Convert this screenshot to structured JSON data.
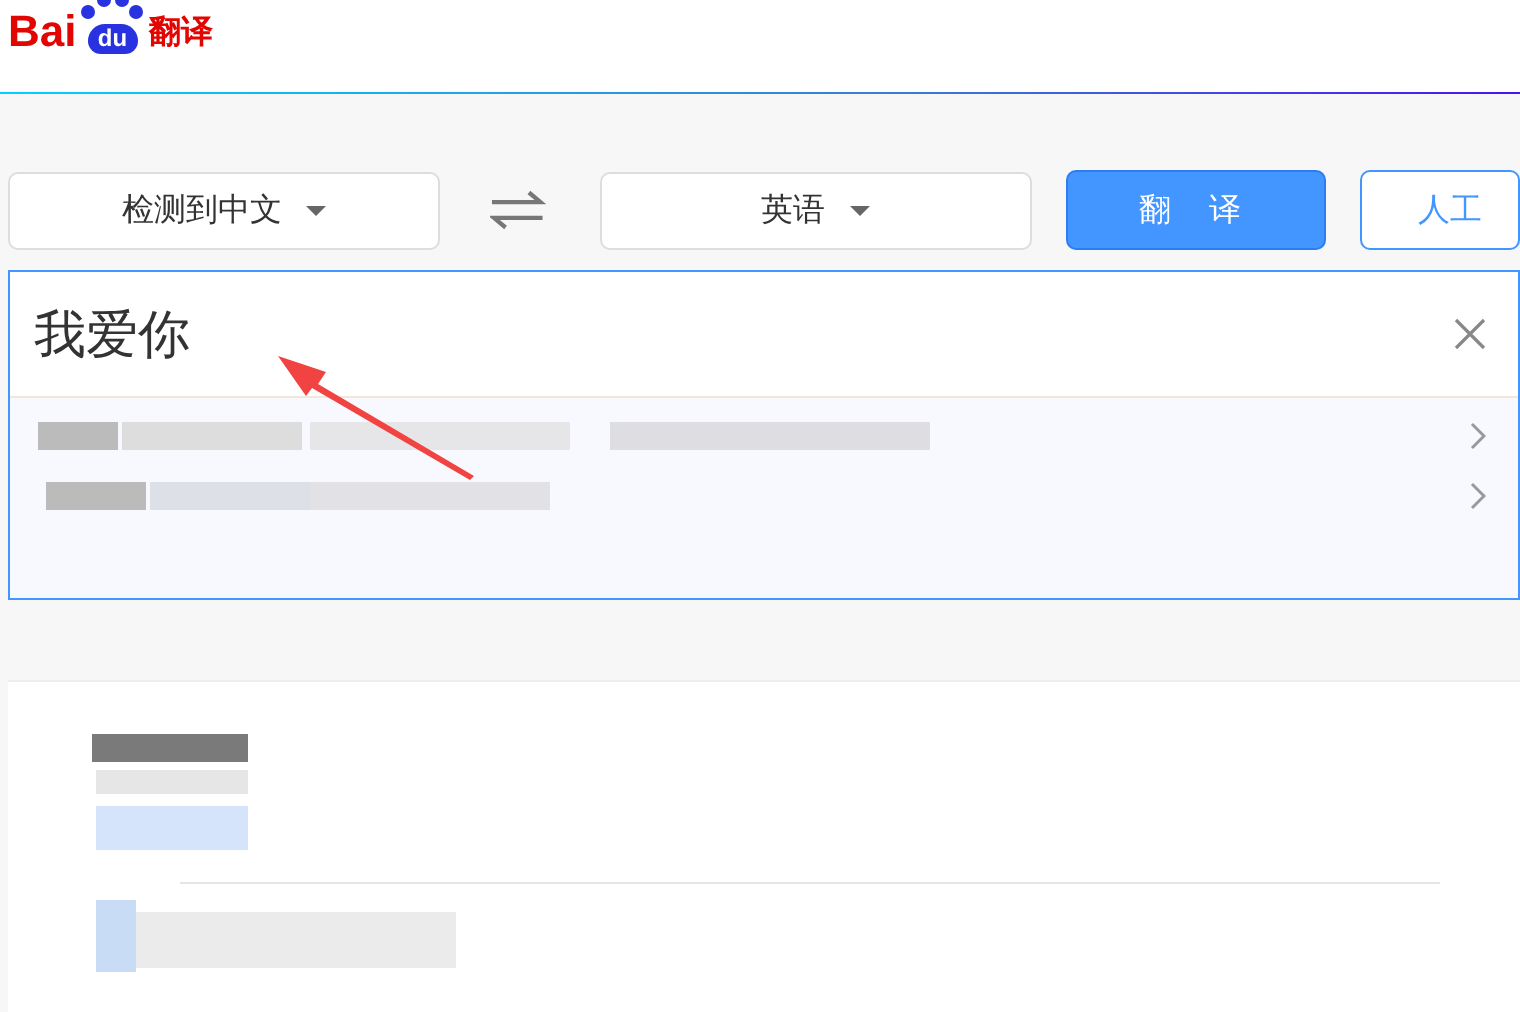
{
  "logo": {
    "text": "Bai",
    "badge": "du",
    "product": "翻译"
  },
  "languages": {
    "source": "检测到中文",
    "target": "英语"
  },
  "buttons": {
    "translate": "翻译",
    "human": "人工"
  },
  "input": {
    "value": "我爱你"
  }
}
